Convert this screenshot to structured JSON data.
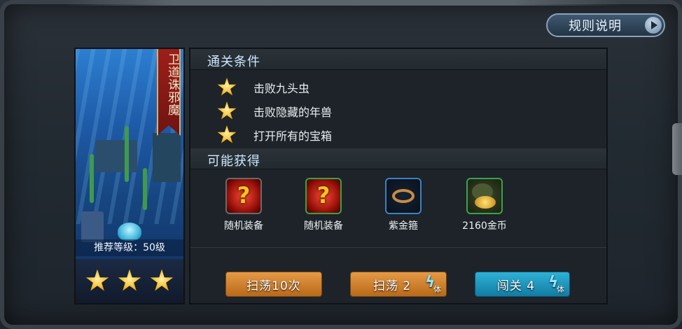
{
  "header": {
    "rules_label": "规则说明"
  },
  "stage": {
    "name": "卫道诛邪魔",
    "recommended_level": "推荐等级：50级",
    "stars_earned": 3,
    "stars_total": 3
  },
  "conditions": {
    "title": "通关条件",
    "items": [
      "击败九头虫",
      "击败隐藏的年兽",
      "打开所有的宝箱"
    ]
  },
  "rewards": {
    "title": "可能获得",
    "items": [
      {
        "name": "随机装备",
        "icon": "mystery-equipment-icon",
        "frame": "gray"
      },
      {
        "name": "随机装备",
        "icon": "mystery-equipment-icon",
        "frame": "green"
      },
      {
        "name": "紫金箍",
        "icon": "golden-headband-icon",
        "frame": "blue"
      },
      {
        "name": "2160金币",
        "icon": "gold-coins-icon",
        "frame": "green"
      }
    ]
  },
  "actions": {
    "sweep10": "扫荡10次",
    "sweep": "扫荡 2",
    "challenge": "闯关 4",
    "stamina_label": "体"
  },
  "colors": {
    "accent_orange": "#d0822f",
    "accent_teal": "#1f98c2",
    "star": "#f2b21b"
  }
}
